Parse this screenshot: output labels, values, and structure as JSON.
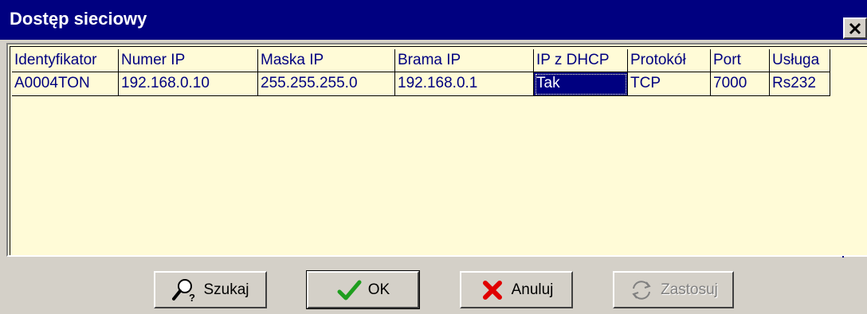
{
  "window": {
    "title": "Dostęp sieciowy"
  },
  "grid": {
    "columns": [
      "Identyfikator",
      "Numer IP",
      "Maska IP",
      "Brama IP",
      "IP z DHCP",
      "Protokół",
      "Port",
      "Usługa"
    ],
    "rows": [
      [
        "A0004TON",
        "192.168.0.10",
        "255.255.255.0",
        "192.168.0.1",
        "Tak",
        "TCP",
        "7000",
        "Rs232"
      ]
    ],
    "selected_cell": {
      "row": 0,
      "column": 4
    }
  },
  "buttons": {
    "search": {
      "label": "Szukaj",
      "icon": "magnifier-question-icon"
    },
    "ok": {
      "label": "OK",
      "icon": "checkmark-icon",
      "default": true
    },
    "cancel": {
      "label": "Anuluj",
      "icon": "red-x-icon"
    },
    "apply": {
      "label": "Zastosuj",
      "icon": "refresh-arrows-icon",
      "enabled": false
    }
  },
  "colors": {
    "titlebar": "#000080",
    "grid_background": "#fffbd7",
    "grid_text": "#000080",
    "window": "#d4d0c8"
  }
}
